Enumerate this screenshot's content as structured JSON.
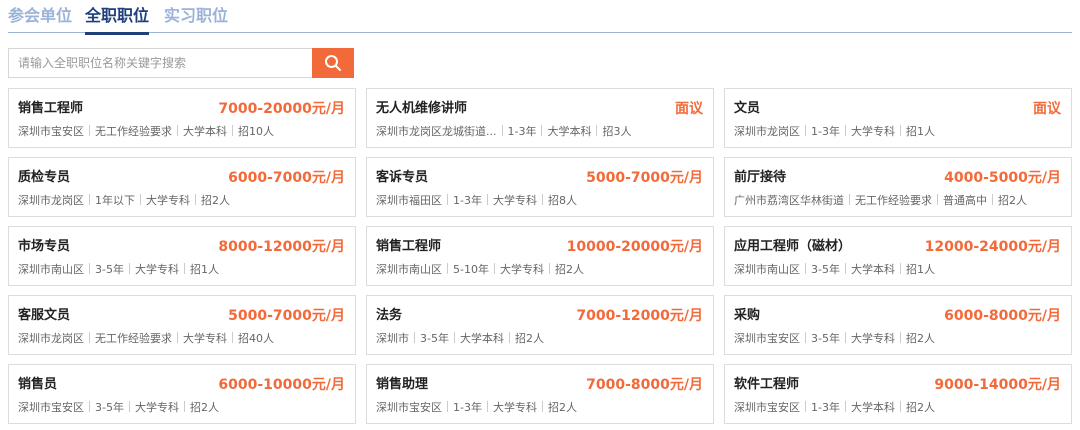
{
  "tabs": [
    {
      "label": "参会单位",
      "active": false
    },
    {
      "label": "全职职位",
      "active": true
    },
    {
      "label": "实习职位",
      "active": false
    }
  ],
  "search": {
    "placeholder": "请输入全职职位名称关键字搜索",
    "value": "",
    "button_icon": "search-icon"
  },
  "colors": {
    "accent": "#f26a3a",
    "tab_active": "#1f3f7a",
    "tab_inactive": "#9bb3d9"
  },
  "jobs": [
    {
      "title": "销售工程师",
      "salary": "7000-20000元/月",
      "location": "深圳市宝安区",
      "experience": "无工作经验要求",
      "education": "大学本科",
      "headcount": "招10人"
    },
    {
      "title": "无人机维修讲师",
      "salary": "面议",
      "location": "深圳市龙岗区龙城街道...",
      "experience": "1-3年",
      "education": "大学本科",
      "headcount": "招3人"
    },
    {
      "title": "文员",
      "salary": "面议",
      "location": "深圳市龙岗区",
      "experience": "1-3年",
      "education": "大学专科",
      "headcount": "招1人"
    },
    {
      "title": "质检专员",
      "salary": "6000-7000元/月",
      "location": "深圳市龙岗区",
      "experience": "1年以下",
      "education": "大学专科",
      "headcount": "招2人"
    },
    {
      "title": "客诉专员",
      "salary": "5000-7000元/月",
      "location": "深圳市福田区",
      "experience": "1-3年",
      "education": "大学专科",
      "headcount": "招8人"
    },
    {
      "title": "前厅接待",
      "salary": "4000-5000元/月",
      "location": "广州市荔湾区华林街道",
      "experience": "无工作经验要求",
      "education": "普通高中",
      "headcount": "招2人"
    },
    {
      "title": "市场专员",
      "salary": "8000-12000元/月",
      "location": "深圳市南山区",
      "experience": "3-5年",
      "education": "大学专科",
      "headcount": "招1人"
    },
    {
      "title": "销售工程师",
      "salary": "10000-20000元/月",
      "location": "深圳市南山区",
      "experience": "5-10年",
      "education": "大学专科",
      "headcount": "招2人"
    },
    {
      "title": "应用工程师（磁材）",
      "salary": "12000-24000元/月",
      "location": "深圳市南山区",
      "experience": "3-5年",
      "education": "大学本科",
      "headcount": "招1人"
    },
    {
      "title": "客服文员",
      "salary": "5000-7000元/月",
      "location": "深圳市龙岗区",
      "experience": "无工作经验要求",
      "education": "大学专科",
      "headcount": "招40人"
    },
    {
      "title": "法务",
      "salary": "7000-12000元/月",
      "location": "深圳市",
      "experience": "3-5年",
      "education": "大学本科",
      "headcount": "招2人"
    },
    {
      "title": "采购",
      "salary": "6000-8000元/月",
      "location": "深圳市宝安区",
      "experience": "3-5年",
      "education": "大学专科",
      "headcount": "招2人"
    },
    {
      "title": "销售员",
      "salary": "6000-10000元/月",
      "location": "深圳市宝安区",
      "experience": "3-5年",
      "education": "大学专科",
      "headcount": "招2人"
    },
    {
      "title": "销售助理",
      "salary": "7000-8000元/月",
      "location": "深圳市宝安区",
      "experience": "1-3年",
      "education": "大学专科",
      "headcount": "招2人"
    },
    {
      "title": "软件工程师",
      "salary": "9000-14000元/月",
      "location": "深圳市宝安区",
      "experience": "1-3年",
      "education": "大学本科",
      "headcount": "招2人"
    }
  ]
}
